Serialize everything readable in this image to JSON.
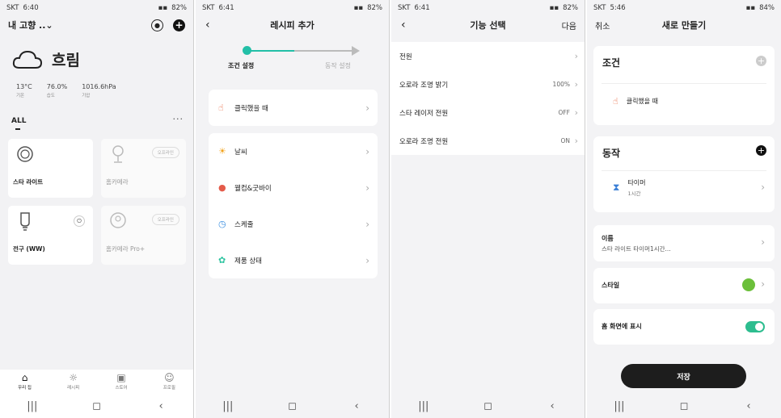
{
  "s1": {
    "status": {
      "carrier": "SKT",
      "time": "6:40",
      "battery": "82%"
    },
    "home": "내 고향 ..⌄",
    "weather": {
      "label": "흐림",
      "temp": "13°C",
      "temp_k": "기온",
      "hum": "76.0%",
      "hum_k": "습도",
      "pres": "1016.6hPa",
      "pres_k": "기압"
    },
    "all": "ALL",
    "dots": "···",
    "cards": [
      {
        "name": "스타 라이트"
      },
      {
        "name": "홈카메라",
        "badge": "오프라인"
      },
      {
        "name": "전구 (WW)"
      },
      {
        "name": "홈카메라 Pro+",
        "badge": "오프라인"
      }
    ],
    "tabs": [
      "우리 집",
      "레시피",
      "스토어",
      "프로필"
    ]
  },
  "s2": {
    "status": {
      "carrier": "SKT",
      "time": "6:41",
      "battery": "82%"
    },
    "title": "레시피 추가",
    "step1": "조건 설정",
    "step2": "동작 설정",
    "items": [
      "클릭했을 때",
      "날씨",
      "웰컴&굿바이",
      "스케줄",
      "제품 상태"
    ]
  },
  "s3": {
    "status": {
      "carrier": "SKT",
      "time": "6:41",
      "battery": "82%"
    },
    "title": "기능 선택",
    "next": "다음",
    "rows": [
      {
        "label": "전원",
        "value": ""
      },
      {
        "label": "오로라 조명 밝기",
        "value": "100%"
      },
      {
        "label": "스타 레이저 전원",
        "value": "OFF"
      },
      {
        "label": "오로라 조명 전원",
        "value": "ON"
      }
    ]
  },
  "s4": {
    "status": {
      "carrier": "SKT",
      "time": "5:46",
      "battery": "84%"
    },
    "cancel": "취소",
    "title": "새로 만들기",
    "cond_title": "조건",
    "cond_item": "클릭했을 때",
    "action_title": "동작",
    "action_item": "타이머",
    "action_sub": "1시간",
    "name_label": "이름",
    "name_value": "스타 라이트 타이머1시간...",
    "style_label": "스타일",
    "home_label": "홈 화면에 표시",
    "home_toggle": true,
    "save": "저장"
  },
  "colors": {
    "accent": "#22bfa7",
    "toggle": "#2dbd8f",
    "style": "#6bbf3a"
  }
}
